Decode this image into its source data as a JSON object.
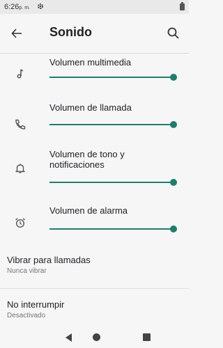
{
  "status_bar": {
    "time": "6:26",
    "ampm": "p. m.",
    "gear_icon": "gear-icon"
  },
  "app_bar": {
    "title": "Sonido",
    "back_icon": "back-arrow-icon",
    "search_icon": "search-icon"
  },
  "sliders": [
    {
      "label": "Volumen multimedia",
      "icon": "music-note-icon",
      "level": 1.0
    },
    {
      "label": "Volumen de llamada",
      "icon": "phone-icon",
      "level": 1.0
    },
    {
      "label": "Volumen de tono y notificaciones",
      "icon": "bell-icon",
      "level": 1.0
    },
    {
      "label": "Volumen de alarma",
      "icon": "alarm-clock-icon",
      "level": 1.0
    }
  ],
  "prefs": [
    {
      "title": "Vibrar para llamadas",
      "subtitle": "Nunca vibrar"
    },
    {
      "title": "No interrumpir",
      "subtitle": "Desactivado"
    }
  ],
  "colors": {
    "accent": "#1b7f6b",
    "background": "#f6f6f6",
    "status_bar": "#e9e9e9"
  },
  "nav_bar": {
    "back_icon": "nav-back-icon",
    "home_icon": "nav-home-icon",
    "recents_icon": "nav-recents-icon"
  }
}
